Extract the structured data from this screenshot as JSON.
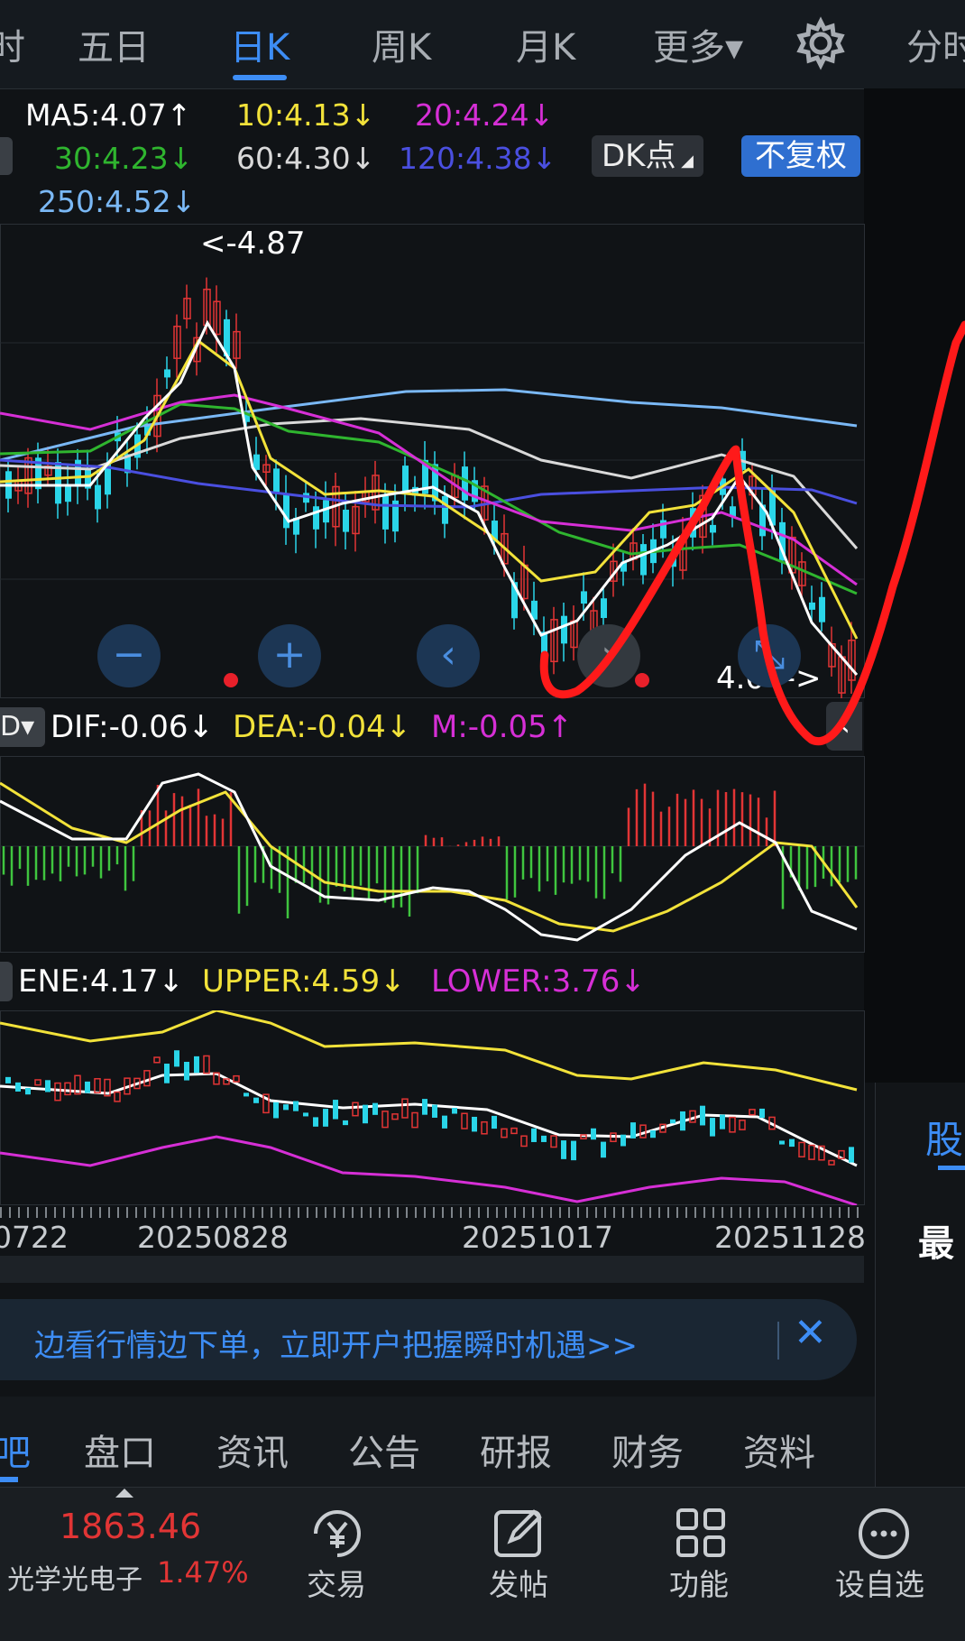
{
  "tabs": [
    {
      "label": "时",
      "active": false
    },
    {
      "label": "五日",
      "active": false
    },
    {
      "label": "日K",
      "active": true
    },
    {
      "label": "周K",
      "active": false
    },
    {
      "label": "月K",
      "active": false
    },
    {
      "label": "更多▾",
      "active": false
    },
    {
      "label": "分时",
      "active": false
    }
  ],
  "ma_lines": {
    "ma5": {
      "text": "MA5:4.07↑",
      "color": "#ffffff"
    },
    "ma10": {
      "text": "10:4.13↓",
      "color": "#f2e23a"
    },
    "ma20": {
      "text": "20:4.24↓",
      "color": "#d62fd6"
    },
    "ma30": {
      "text": "30:4.23↓",
      "color": "#2fb52f"
    },
    "ma60": {
      "text": "60:4.30↓",
      "color": "#d9d9d9"
    },
    "ma120": {
      "text": "120:4.38↓",
      "color": "#4a4fe0"
    },
    "ma250": {
      "text": "250:4.52↓",
      "color": "#7ab8f5"
    }
  },
  "dk_button": "DK点",
  "fuquan_button": "不复权",
  "high_label": "<-4.87",
  "low_label": "4.04->",
  "macd": {
    "selector": "D▾",
    "dif": "DIF:-0.06↓",
    "dea": "DEA:-0.04↓",
    "m": "M:-0.05↑"
  },
  "ene": {
    "ene": "ENE:4.17↓",
    "upper": "UPPER:4.59↓",
    "lower": "LOWER:3.76↓"
  },
  "dates": [
    "0722",
    "20250828",
    "20251017",
    "20251128"
  ],
  "banner": {
    "text": "边看行情边下单，立即开户把握瞬时机遇>>"
  },
  "sub_tabs": [
    "吧",
    "盘口",
    "资讯",
    "公告",
    "研报",
    "财务",
    "资料"
  ],
  "side_panel": {
    "tab": "股",
    "label": "最"
  },
  "index": {
    "value": "1863.46",
    "name": "光学光电子",
    "change": "1.47%"
  },
  "bottom_actions": [
    {
      "label": "交易",
      "icon": "yuan-icon"
    },
    {
      "label": "发帖",
      "icon": "edit-icon"
    },
    {
      "label": "功能",
      "icon": "grid-icon"
    },
    {
      "label": "设自选",
      "icon": "more-circle-icon"
    }
  ],
  "colors": {
    "accent": "#3d8df5",
    "up": "#e23535",
    "down": "#2ad5e8",
    "annotation": "#ff1a1a"
  }
}
